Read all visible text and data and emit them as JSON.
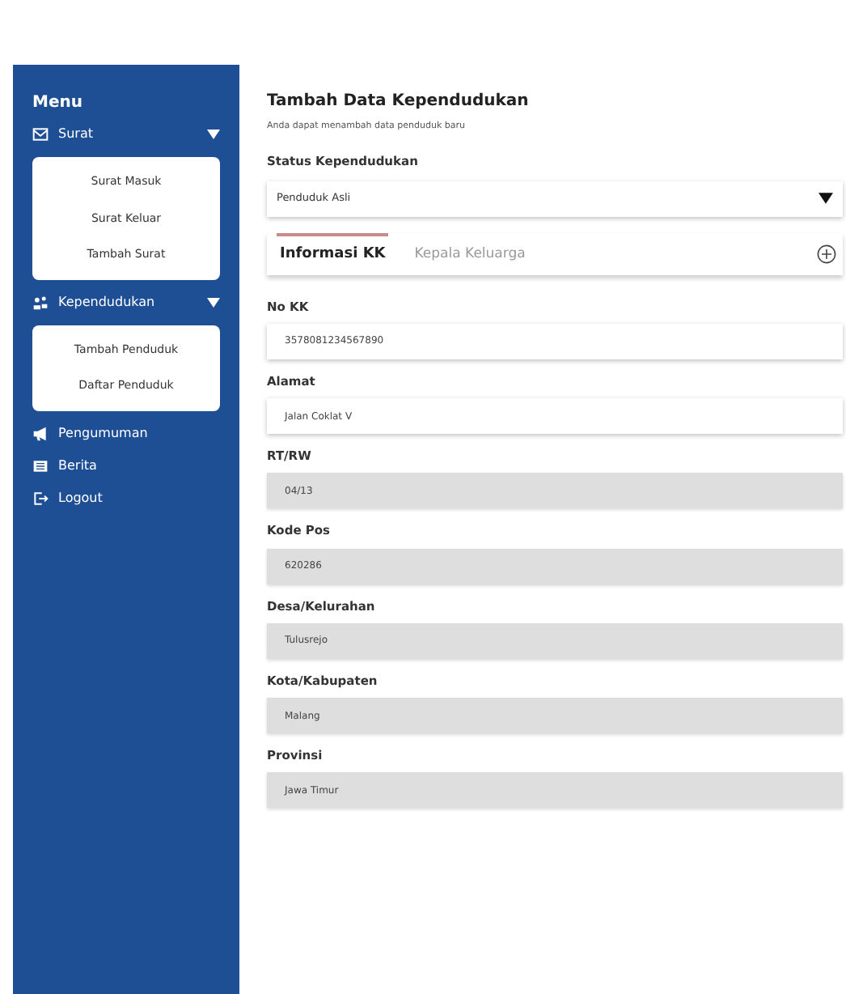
{
  "sidebar": {
    "title": "Menu",
    "items": [
      {
        "label": "Surat",
        "expanded": true,
        "children": [
          {
            "label": "Surat Masuk"
          },
          {
            "label": "Surat Keluar"
          },
          {
            "label": "Tambah Surat"
          }
        ]
      },
      {
        "label": "Kependudukan",
        "expanded": true,
        "children": [
          {
            "label": "Tambah Penduduk"
          },
          {
            "label": "Daftar Penduduk"
          }
        ]
      },
      {
        "label": "Pengumuman"
      },
      {
        "label": "Berita"
      },
      {
        "label": "Logout"
      }
    ]
  },
  "form": {
    "title": "Tambah Data Kependudukan",
    "subtitle": "Anda dapat menambah data penduduk baru",
    "status_label": "Status Kependudukan",
    "status_value": "Penduduk Asli",
    "tabs": [
      {
        "label": "Informasi KK",
        "selected": true
      },
      {
        "label": "Kepala Keluarga",
        "selected": false
      }
    ],
    "fields": [
      {
        "label": "No KK",
        "value": "3578081234567890",
        "disabled": false
      },
      {
        "label": "Alamat",
        "value": "Jalan Coklat V",
        "disabled": false
      },
      {
        "label": "RT/RW",
        "value": "04/13",
        "disabled": true
      },
      {
        "label": "Kode Pos",
        "value": "620286",
        "disabled": true
      },
      {
        "label": "Desa/Kelurahan",
        "value": "Tulusrejo",
        "disabled": true
      },
      {
        "label": "Kota/Kabupaten",
        "value": "Malang",
        "disabled": true
      },
      {
        "label": "Provinsi",
        "value": "Jawa Timur",
        "disabled": true
      }
    ]
  }
}
